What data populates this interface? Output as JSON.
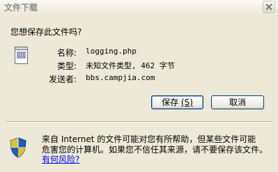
{
  "window": {
    "title": "文件下载"
  },
  "question": "您想保存此文件吗?",
  "file": {
    "name_label": "名称:",
    "name_value": "logging.php",
    "type_label": "类型:",
    "type_value": "未知文件类型, 462 字节",
    "from_label": "发送者:",
    "from_value": "bbs.campjia.com"
  },
  "buttons": {
    "save_label": "保存",
    "save_accel": "(S)",
    "cancel_label": "取消"
  },
  "warning": {
    "line1": "来自 Internet 的文件可能对您有所帮助，但某些文件可能",
    "line2": "危害您的计算机。如果您不信任其来源，请不要保存该文件。",
    "link": "有何风险?"
  },
  "icons": {
    "close": "close-icon",
    "file": "file-icon",
    "shield": "shield-icon"
  }
}
